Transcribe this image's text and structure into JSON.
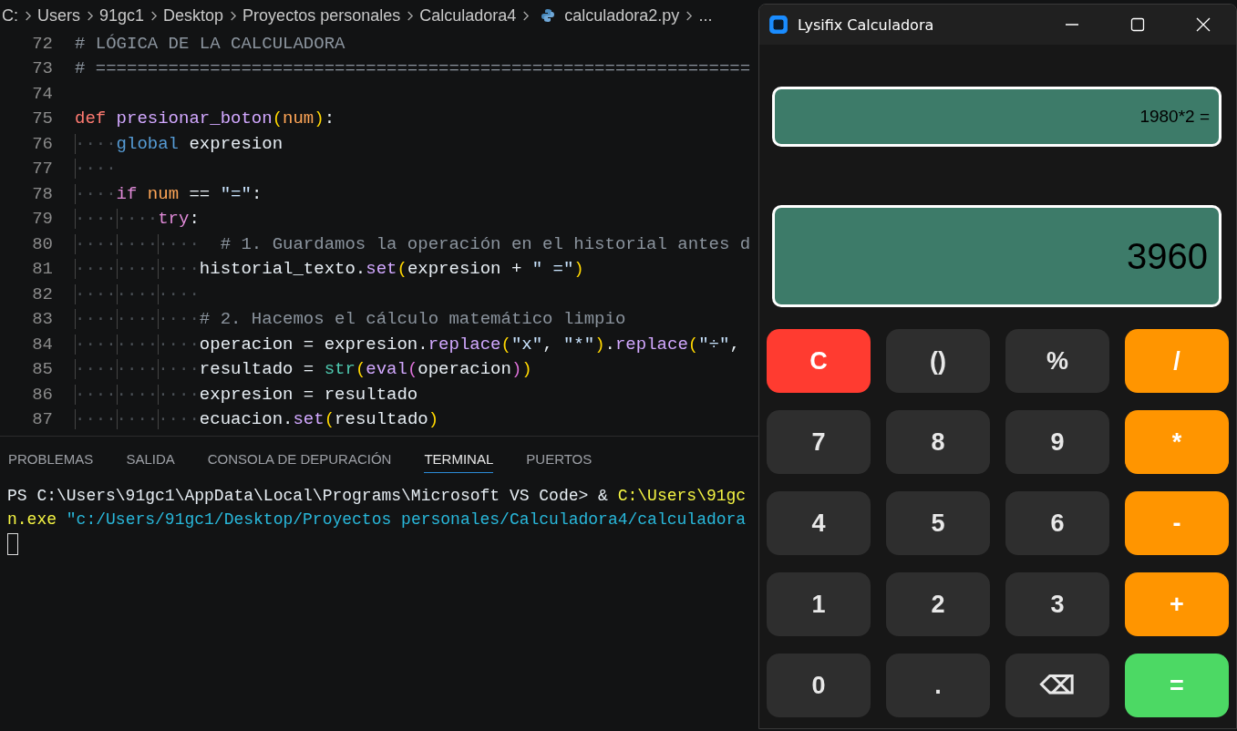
{
  "breadcrumb": [
    {
      "kind": "folder",
      "label": "C:"
    },
    {
      "kind": "folder",
      "label": "Users"
    },
    {
      "kind": "folder",
      "label": "91gc1"
    },
    {
      "kind": "folder",
      "label": "Desktop"
    },
    {
      "kind": "folder",
      "label": "Proyectos personales"
    },
    {
      "kind": "folder",
      "label": "Calculadora4"
    },
    {
      "kind": "file",
      "label": "calculadora2.py"
    },
    {
      "kind": "more",
      "label": "..."
    }
  ],
  "code_lines": [
    {
      "number": "72",
      "tokens": [
        {
          "kind": "comment",
          "text": "# LÓGICA DE LA CALCULADORA"
        }
      ]
    },
    {
      "number": "73",
      "tokens": [
        {
          "kind": "comment",
          "text": "# ==============================================================="
        }
      ]
    },
    {
      "number": "74"
    },
    {
      "number": "75",
      "tokens": [
        {
          "kind": "keyword",
          "text": "def "
        },
        {
          "kind": "func",
          "text": "presionar_boton"
        },
        {
          "kind": "paren1",
          "text": "("
        },
        {
          "kind": "param",
          "text": "num"
        },
        {
          "kind": "paren1",
          "text": ")"
        },
        {
          "kind": "plain",
          "text": ":"
        }
      ]
    },
    {
      "number": "76",
      "tokens": [
        {
          "kind": "ws",
          "text": "····"
        },
        {
          "kind": "builtin",
          "text": "global"
        },
        {
          "kind": "plain",
          "text": " expresion"
        }
      ]
    },
    {
      "number": "77",
      "tokens": [
        {
          "kind": "ws",
          "text": "····"
        }
      ]
    },
    {
      "number": "78",
      "tokens": [
        {
          "kind": "ws",
          "text": "····"
        },
        {
          "kind": "control",
          "text": "if "
        },
        {
          "kind": "param",
          "text": "num"
        },
        {
          "kind": "plain",
          "text": " == "
        },
        {
          "kind": "string",
          "text": "\"=\""
        },
        {
          "kind": "plain",
          "text": ":"
        }
      ]
    },
    {
      "number": "79",
      "tokens": [
        {
          "kind": "ws",
          "text": "········"
        },
        {
          "kind": "control",
          "text": "try"
        },
        {
          "kind": "plain",
          "text": ":"
        }
      ]
    },
    {
      "number": "80",
      "tokens": [
        {
          "kind": "ws",
          "text": "············"
        },
        {
          "kind": "comment",
          "text": "  # 1. Guardamos la operación en el historial antes d"
        }
      ]
    },
    {
      "number": "81",
      "tokens": [
        {
          "kind": "ws",
          "text": "············"
        },
        {
          "kind": "plain",
          "text": "historial_texto."
        },
        {
          "kind": "method",
          "text": "set"
        },
        {
          "kind": "paren1",
          "text": "("
        },
        {
          "kind": "plain",
          "text": "expresion + "
        },
        {
          "kind": "string",
          "text": "\" =\""
        },
        {
          "kind": "paren1",
          "text": ")"
        }
      ]
    },
    {
      "number": "82",
      "tokens": [
        {
          "kind": "ws",
          "text": "············"
        }
      ]
    },
    {
      "number": "83",
      "tokens": [
        {
          "kind": "ws",
          "text": "············"
        },
        {
          "kind": "comment",
          "text": "# 2. Hacemos el cálculo matemático limpio"
        }
      ]
    },
    {
      "number": "84",
      "tokens": [
        {
          "kind": "ws",
          "text": "············"
        },
        {
          "kind": "plain",
          "text": "operacion = expresion."
        },
        {
          "kind": "method",
          "text": "replace"
        },
        {
          "kind": "paren1",
          "text": "("
        },
        {
          "kind": "string",
          "text": "\"x\""
        },
        {
          "kind": "plain",
          "text": ", "
        },
        {
          "kind": "string",
          "text": "\"*\""
        },
        {
          "kind": "paren1",
          "text": ")"
        },
        {
          "kind": "plain",
          "text": "."
        },
        {
          "kind": "method",
          "text": "replace"
        },
        {
          "kind": "paren1",
          "text": "("
        },
        {
          "kind": "string",
          "text": "\"÷\""
        },
        {
          "kind": "plain",
          "text": ","
        }
      ]
    },
    {
      "number": "85",
      "tokens": [
        {
          "kind": "ws",
          "text": "············"
        },
        {
          "kind": "plain",
          "text": "resultado = "
        },
        {
          "kind": "type",
          "text": "str"
        },
        {
          "kind": "paren1",
          "text": "("
        },
        {
          "kind": "method",
          "text": "eval"
        },
        {
          "kind": "paren2",
          "text": "("
        },
        {
          "kind": "plain",
          "text": "operacion"
        },
        {
          "kind": "paren2",
          "text": ")"
        },
        {
          "kind": "paren1",
          "text": ")"
        }
      ]
    },
    {
      "number": "86",
      "tokens": [
        {
          "kind": "ws",
          "text": "············"
        },
        {
          "kind": "plain",
          "text": "expresion = resultado"
        }
      ]
    },
    {
      "number": "87",
      "tokens": [
        {
          "kind": "ws",
          "text": "············"
        },
        {
          "kind": "plain",
          "text": "ecuacion."
        },
        {
          "kind": "method",
          "text": "set"
        },
        {
          "kind": "paren1",
          "text": "("
        },
        {
          "kind": "plain",
          "text": "resultado"
        },
        {
          "kind": "paren1",
          "text": ")"
        }
      ]
    }
  ],
  "panel_tabs": [
    {
      "label": "PROBLEMAS",
      "selected": false
    },
    {
      "label": "SALIDA",
      "selected": false
    },
    {
      "label": "CONSOLA DE DEPURACIÓN",
      "selected": false
    },
    {
      "label": "TERMINAL",
      "selected": true
    },
    {
      "label": "PUERTOS",
      "selected": false
    }
  ],
  "terminal_lines": [
    [
      {
        "kind": "plain",
        "text": "PS C:\\Users\\91gc1\\AppData\\Local\\Programs\\Microsoft VS Code> & "
      },
      {
        "kind": "command",
        "text": "C:\\Users\\91gc"
      }
    ],
    [
      {
        "kind": "command",
        "text": "n.exe"
      },
      {
        "kind": "argument",
        "text": " \"c:/Users/91gc1/Desktop/Proyectos personales/Calculadora4/calculadora"
      }
    ]
  ],
  "calculator": {
    "title": "Lysifix Calculadora",
    "history": "1980*2 =",
    "display": "3960",
    "buttons": [
      {
        "label": "C",
        "kind": "clear"
      },
      {
        "label": "()",
        "kind": "function"
      },
      {
        "label": "%",
        "kind": "function"
      },
      {
        "label": "/",
        "kind": "operator"
      },
      {
        "label": "7",
        "kind": "number"
      },
      {
        "label": "8",
        "kind": "number"
      },
      {
        "label": "9",
        "kind": "number"
      },
      {
        "label": "*",
        "kind": "operator"
      },
      {
        "label": "4",
        "kind": "number"
      },
      {
        "label": "5",
        "kind": "number"
      },
      {
        "label": "6",
        "kind": "number"
      },
      {
        "label": "-",
        "kind": "operator"
      },
      {
        "label": "1",
        "kind": "number"
      },
      {
        "label": "2",
        "kind": "number"
      },
      {
        "label": "3",
        "kind": "number"
      },
      {
        "label": "+",
        "kind": "operator"
      },
      {
        "label": "0",
        "kind": "number"
      },
      {
        "label": ".",
        "kind": "number"
      },
      {
        "label": "⌫",
        "kind": "function"
      },
      {
        "label": "=",
        "kind": "equals"
      }
    ]
  }
}
